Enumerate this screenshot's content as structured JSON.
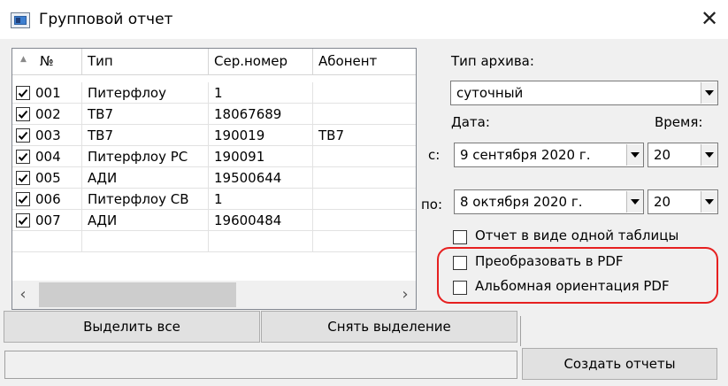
{
  "window": {
    "title": "Групповой отчет",
    "close_glyph": "✕",
    "icon": "app-window-icon"
  },
  "table": {
    "headers": {
      "num": "№",
      "type": "Тип",
      "serial": "Сер.номер",
      "subscriber": "Абонент"
    },
    "rows": [
      {
        "checked": true,
        "num": "001",
        "type": "Питерфлоу",
        "serial": "1",
        "subscriber": ""
      },
      {
        "checked": true,
        "num": "002",
        "type": "ТВ7",
        "serial": "18067689",
        "subscriber": ""
      },
      {
        "checked": true,
        "num": "003",
        "type": "ТВ7",
        "serial": "190019",
        "subscriber": "ТВ7"
      },
      {
        "checked": true,
        "num": "004",
        "type": "Питерфлоу РС",
        "serial": "190091",
        "subscriber": ""
      },
      {
        "checked": true,
        "num": "005",
        "type": "АДИ",
        "serial": "19500644",
        "subscriber": ""
      },
      {
        "checked": true,
        "num": "006",
        "type": "Питерфлоу СВ",
        "serial": "1",
        "subscriber": ""
      },
      {
        "checked": true,
        "num": "007",
        "type": "АДИ",
        "serial": "19600484",
        "subscriber": ""
      }
    ]
  },
  "archive": {
    "type_label": "Тип архива:",
    "type_value": "суточный",
    "date_label": "Дата:",
    "time_label": "Время:",
    "from_label": "с:",
    "from_date": "9 сентября 2020 г.",
    "from_time": "20",
    "to_label": "по:",
    "to_date": "8 октября 2020 г.",
    "to_time": "20"
  },
  "options": {
    "single_table": {
      "label": "Отчет в виде одной таблицы",
      "checked": false
    },
    "convert_pdf": {
      "label": "Преобразовать в PDF",
      "checked": false
    },
    "landscape_pdf": {
      "label": "Альбомная ориентация PDF",
      "checked": false
    },
    "highlight_color": "#e62020"
  },
  "buttons": {
    "select_all": "Выделить все",
    "deselect": "Снять выделение",
    "create": "Создать отчеты"
  },
  "status_text": ""
}
